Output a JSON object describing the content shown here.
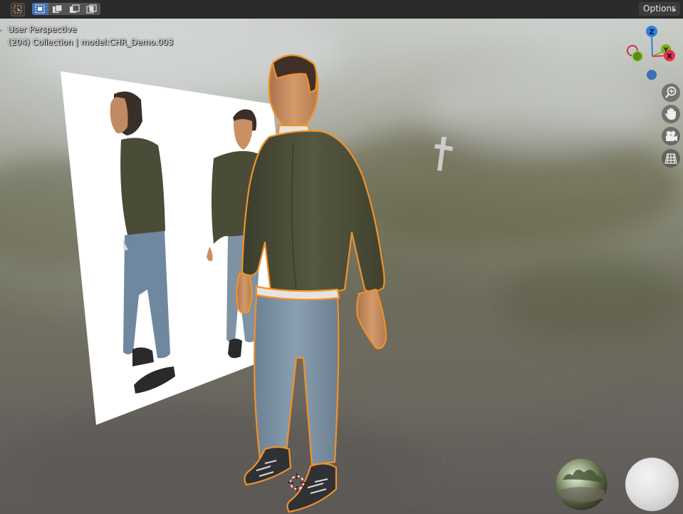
{
  "header": {
    "tool_icon": "select-box-icon",
    "mode_icons": [
      "select-new-icon",
      "select-extend-icon",
      "select-subtract-icon",
      "select-intersect-icon"
    ],
    "options_label": "Options"
  },
  "overlay": {
    "view_name": "User Perspective",
    "collection_info": "(204) Collection | model:CHR_Demo.003"
  },
  "gizmo": {
    "axes": [
      {
        "label": "Z",
        "color": "#2f7fdd"
      },
      {
        "label": "Y",
        "color": "#7cb020"
      },
      {
        "label": "X",
        "color": "#e8304f"
      }
    ]
  },
  "nav_controls": [
    "zoom-icon",
    "pan-hand-icon",
    "camera-icon",
    "perspective-grid-icon"
  ],
  "colors": {
    "header_bg": "#2b2b2b",
    "selection_outline": "#f0922a",
    "sweater": "#4a4c37",
    "jeans": "#7e92a4",
    "skin": "#c99063"
  }
}
